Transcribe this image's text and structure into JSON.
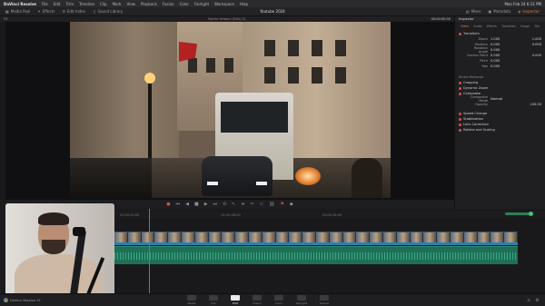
{
  "menubar": {
    "app": "DaVinci Resolve",
    "menus": [
      "File",
      "Edit",
      "Trim",
      "Timeline",
      "Clip",
      "Mark",
      "View",
      "Playback",
      "Fusion",
      "Color",
      "Fairlight",
      "Workspace",
      "Help"
    ],
    "clock": "Mon Feb 24 6:11 PM"
  },
  "toolbar": {
    "media_pool": "Media Pool",
    "effects": "Effects",
    "edit_index": "Edit Index",
    "sound_library": "Sound Library",
    "project_title": "Youtube 2024",
    "mixer": "Mixer",
    "metadata": "Metadata",
    "inspector": "Inspector"
  },
  "viewer": {
    "fit": "Fit",
    "clip_name": "Nacho Velasco (Edit) 01",
    "timecode": "00:00:00:00"
  },
  "inspector": {
    "title": "Inspector",
    "tabs": [
      "Video",
      "Audio",
      "Effects",
      "Transition",
      "Image",
      "File"
    ],
    "transform": "Transform",
    "rows": [
      {
        "label": "Zoom",
        "a": "1.000",
        "b": "1.000"
      },
      {
        "label": "Position",
        "a": "0.000",
        "b": "0.000"
      },
      {
        "label": "Rotation Angle",
        "a": "0.000",
        "b": ""
      },
      {
        "label": "Anchor Point",
        "a": "0.000",
        "b": "0.000"
      },
      {
        "label": "Pitch",
        "a": "0.000",
        "b": ""
      },
      {
        "label": "Yaw",
        "a": "0.000",
        "b": ""
      }
    ],
    "smart_reframe": "Smart Reframe",
    "sections": [
      "Cropping",
      "Dynamic Zoom",
      "Composite"
    ],
    "composite_rows": [
      {
        "label": "Composite Mode",
        "a": "Normal",
        "b": ""
      },
      {
        "label": "Opacity",
        "a": "",
        "b": "100.00"
      }
    ],
    "sections2": [
      "Speed Change",
      "Stabilization",
      "Lens Correction",
      "Retime and Scaling"
    ]
  },
  "timeline": {
    "ruler": [
      "01:00:00:00",
      "01:00:08:00",
      "01:00:16:00"
    ],
    "clip_count": 30
  },
  "bottom": {
    "brand": "DaVinci Resolve 19",
    "pages": [
      "Media",
      "Cut",
      "Edit",
      "Fusion",
      "Color",
      "Fairlight",
      "Deliver"
    ],
    "active_page": "Edit"
  },
  "colors": {
    "accent": "#e07a3a",
    "playhead": "#e04b4b",
    "audio_track": "#1f6f56",
    "video_track": "#2a4a63"
  }
}
